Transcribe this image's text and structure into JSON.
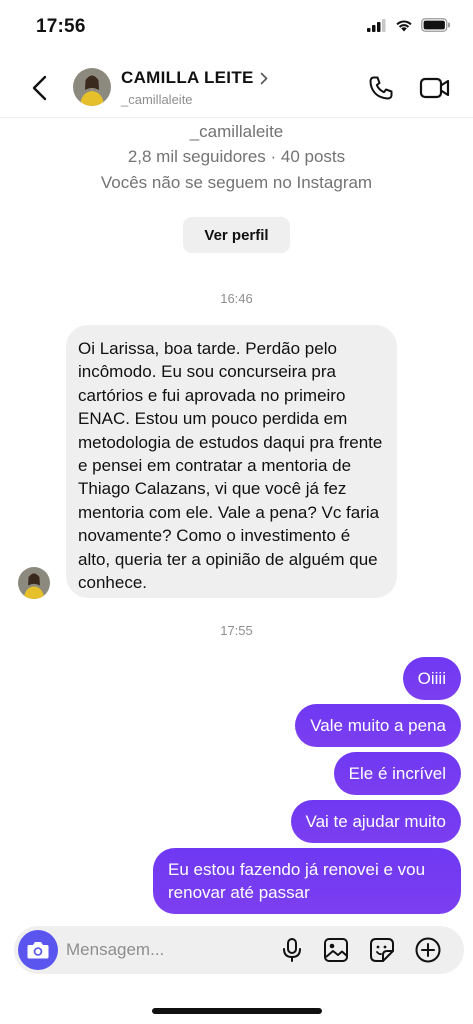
{
  "status_bar": {
    "time": "17:56"
  },
  "header": {
    "name": "CAMILLA LEITE",
    "handle": "_camillaleite"
  },
  "profile_info": {
    "handle": "_camillaleite",
    "followers": "2,8 mil seguidores · 40 posts",
    "relationship": "Vocês não se seguem no Instagram",
    "view_profile_label": "Ver perfil"
  },
  "timestamps": [
    "16:46",
    "17:55"
  ],
  "incoming_message": "Oi Larissa, boa tarde. Perdão pelo incômodo. Eu sou concurseira pra cartórios e fui aprovada no primeiro ENAC. Estou um pouco perdida em metodologia de estudos daqui pra frente e pensei em contratar a mentoria de Thiago Calazans, vi que você já fez mentoria com ele. Vale a pena? Vc faria novamente? Como o investimento é alto, queria ter a opinião de alguém que conhece.",
  "outgoing_messages": [
    "Oiiii",
    "Vale muito a pena",
    "Ele é incrível",
    "Vai te ajudar muito",
    "Eu estou fazendo já renovei e vou renovar até passar"
  ],
  "composer": {
    "placeholder": "Mensagem..."
  },
  "icons": {
    "back": "chevron-left-icon",
    "call": "phone-icon",
    "video": "video-camera-icon",
    "camera": "camera-icon",
    "mic": "microphone-icon",
    "gallery": "image-icon",
    "sticker": "sticker-icon",
    "add": "plus-circle-icon"
  },
  "colors": {
    "accent": "#7a3ff0",
    "camera_button": "#5b55f0",
    "incoming_bubble": "#efefef"
  }
}
